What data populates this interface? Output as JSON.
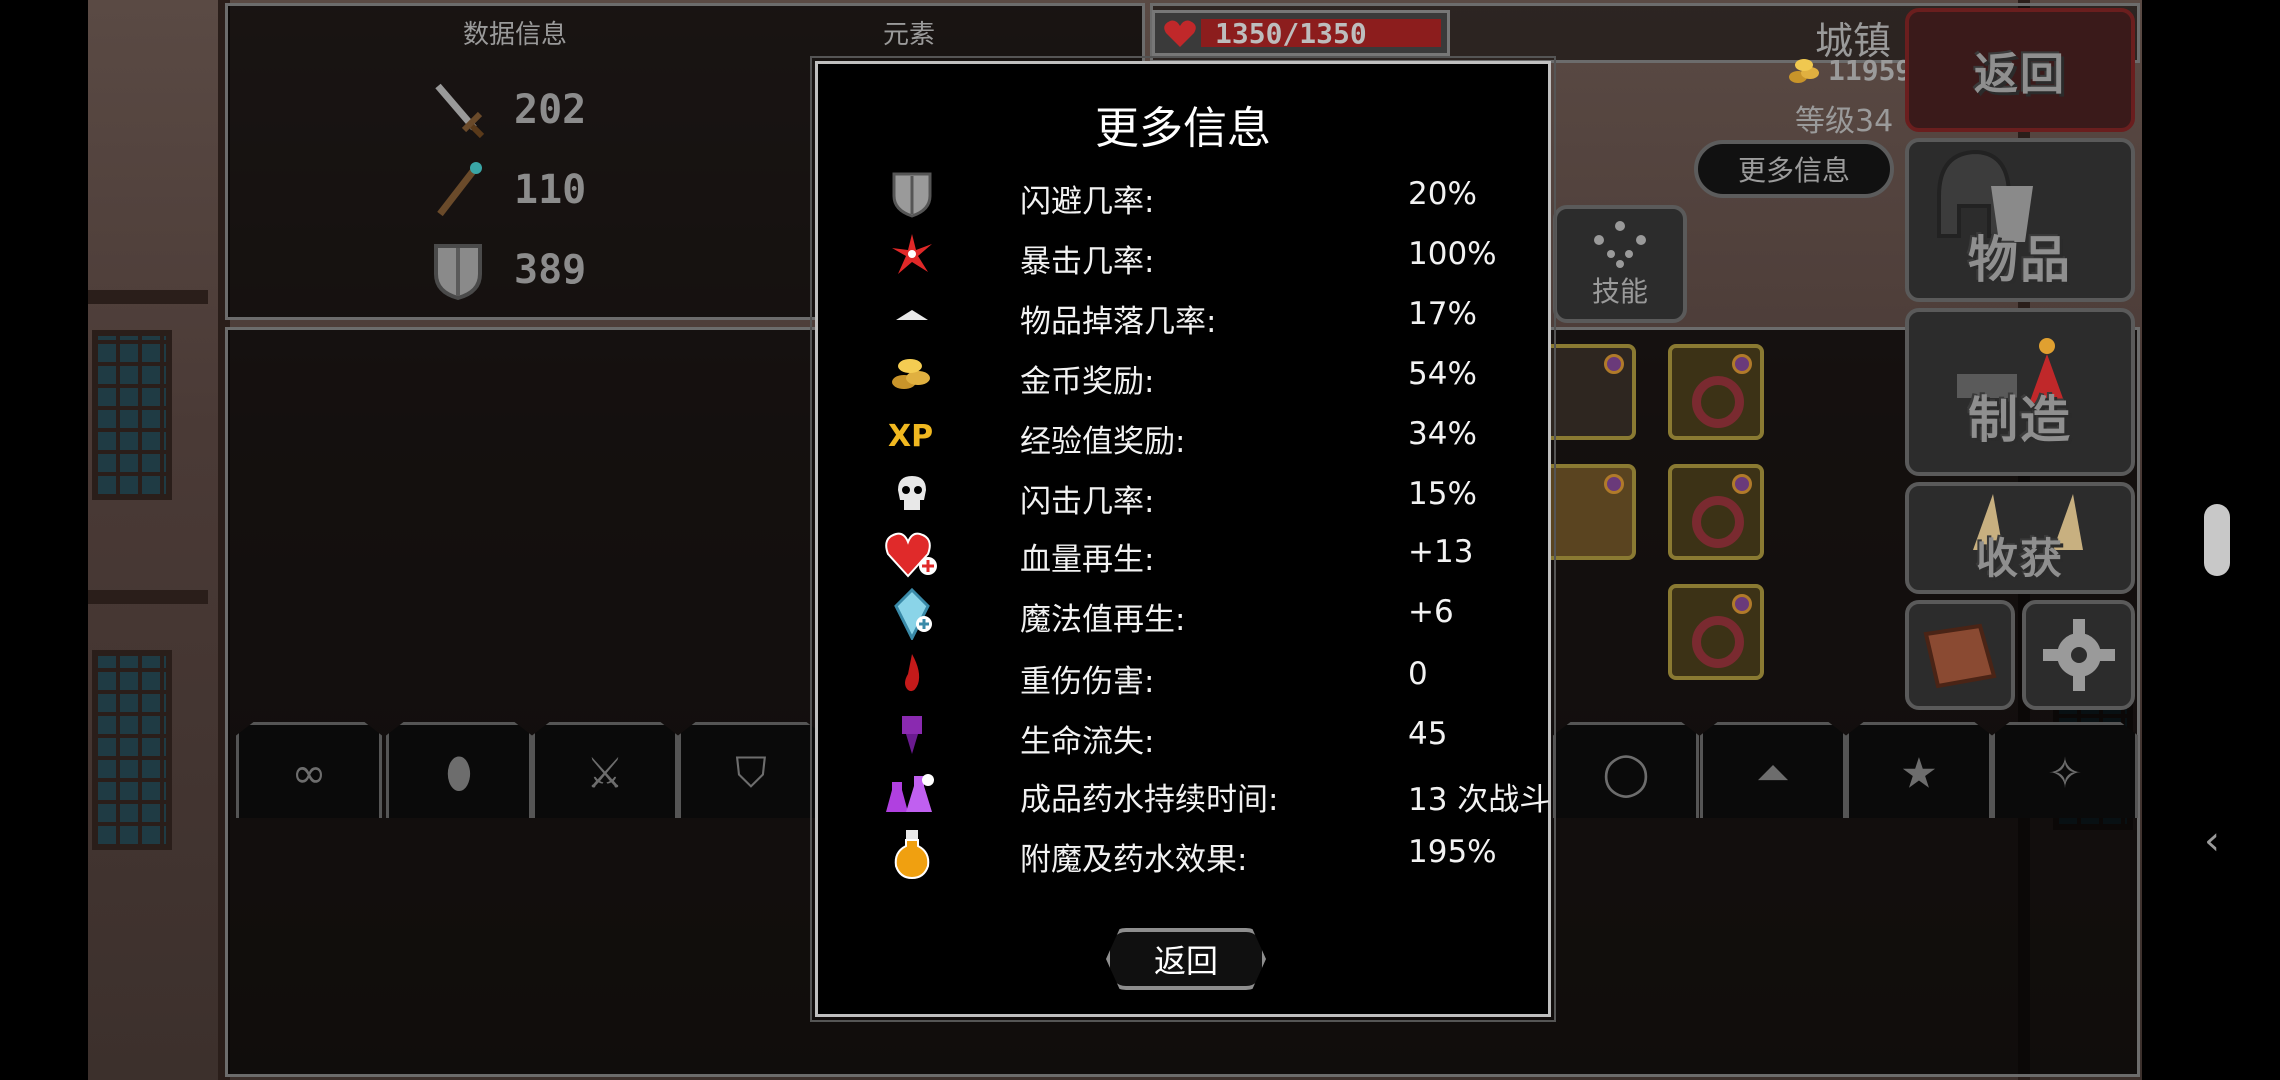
{
  "left_panel": {
    "tab_data": "数据信息",
    "tab_elements": "元素",
    "stats": [
      {
        "icon": "sword-icon",
        "value": "202"
      },
      {
        "icon": "staff-icon",
        "value": "110"
      },
      {
        "icon": "shield-icon",
        "value": "389"
      }
    ]
  },
  "status": {
    "hp": "1350/1350",
    "hp_fraction": 1.0,
    "location": "城镇",
    "gold": "11959",
    "level": "等级34",
    "more_info_button": "更多信息",
    "skills_label": "技能"
  },
  "side_menu": {
    "back": "返回",
    "items": "物品",
    "craft": "制造",
    "harvest": "收获"
  },
  "category_tabs": [
    "infinity-icon",
    "bag-icon",
    "sword-icon",
    "shield-icon",
    "ring-icon",
    "hat-icon",
    "star-icon",
    "wand-icon"
  ],
  "modal": {
    "title": "更多信息",
    "rows": [
      {
        "icon": "shield-dodge-icon",
        "label": "闪避几率:",
        "value": "20%"
      },
      {
        "icon": "critical-spark-icon",
        "label": "暴击几率:",
        "value": "100%"
      },
      {
        "icon": "item-drop-icon",
        "label": "物品掉落几率:",
        "value": "17%"
      },
      {
        "icon": "gold-coins-icon",
        "label": "金币奖励:",
        "value": "54%"
      },
      {
        "icon": "xp-icon",
        "label": "经验值奖励:",
        "value": "34%"
      },
      {
        "icon": "skull-icon",
        "label": "闪击几率:",
        "value": "15%"
      },
      {
        "icon": "heart-plus-icon",
        "label": "血量再生:",
        "value": "+13"
      },
      {
        "icon": "mana-crystal-icon",
        "label": "魔法值再生:",
        "value": "+6"
      },
      {
        "icon": "blood-drop-icon",
        "label": "重伤伤害:",
        "value": "0"
      },
      {
        "icon": "purple-drop-icon",
        "label": "生命流失:",
        "value": "45"
      },
      {
        "icon": "potion-flasks-icon",
        "label": "成品药水持续时间:",
        "value": "13 次战斗"
      },
      {
        "icon": "orange-potion-icon",
        "label": "附魔及药水效果:",
        "value": "195%"
      }
    ],
    "back_button": "返回"
  },
  "colors": {
    "modal_border": "#bfbfbf",
    "hp_red": "#8c1d1d",
    "panel_border": "#6c6c6c"
  }
}
